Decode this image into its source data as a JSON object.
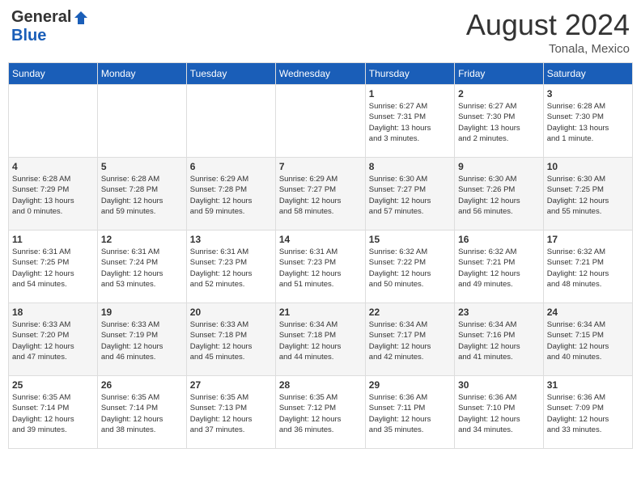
{
  "header": {
    "logo_general": "General",
    "logo_blue": "Blue",
    "month_year": "August 2024",
    "location": "Tonala, Mexico"
  },
  "weekdays": [
    "Sunday",
    "Monday",
    "Tuesday",
    "Wednesday",
    "Thursday",
    "Friday",
    "Saturday"
  ],
  "weeks": [
    [
      {
        "day": "",
        "info": ""
      },
      {
        "day": "",
        "info": ""
      },
      {
        "day": "",
        "info": ""
      },
      {
        "day": "",
        "info": ""
      },
      {
        "day": "1",
        "info": "Sunrise: 6:27 AM\nSunset: 7:31 PM\nDaylight: 13 hours\nand 3 minutes."
      },
      {
        "day": "2",
        "info": "Sunrise: 6:27 AM\nSunset: 7:30 PM\nDaylight: 13 hours\nand 2 minutes."
      },
      {
        "day": "3",
        "info": "Sunrise: 6:28 AM\nSunset: 7:30 PM\nDaylight: 13 hours\nand 1 minute."
      }
    ],
    [
      {
        "day": "4",
        "info": "Sunrise: 6:28 AM\nSunset: 7:29 PM\nDaylight: 13 hours\nand 0 minutes."
      },
      {
        "day": "5",
        "info": "Sunrise: 6:28 AM\nSunset: 7:28 PM\nDaylight: 12 hours\nand 59 minutes."
      },
      {
        "day": "6",
        "info": "Sunrise: 6:29 AM\nSunset: 7:28 PM\nDaylight: 12 hours\nand 59 minutes."
      },
      {
        "day": "7",
        "info": "Sunrise: 6:29 AM\nSunset: 7:27 PM\nDaylight: 12 hours\nand 58 minutes."
      },
      {
        "day": "8",
        "info": "Sunrise: 6:30 AM\nSunset: 7:27 PM\nDaylight: 12 hours\nand 57 minutes."
      },
      {
        "day": "9",
        "info": "Sunrise: 6:30 AM\nSunset: 7:26 PM\nDaylight: 12 hours\nand 56 minutes."
      },
      {
        "day": "10",
        "info": "Sunrise: 6:30 AM\nSunset: 7:25 PM\nDaylight: 12 hours\nand 55 minutes."
      }
    ],
    [
      {
        "day": "11",
        "info": "Sunrise: 6:31 AM\nSunset: 7:25 PM\nDaylight: 12 hours\nand 54 minutes."
      },
      {
        "day": "12",
        "info": "Sunrise: 6:31 AM\nSunset: 7:24 PM\nDaylight: 12 hours\nand 53 minutes."
      },
      {
        "day": "13",
        "info": "Sunrise: 6:31 AM\nSunset: 7:23 PM\nDaylight: 12 hours\nand 52 minutes."
      },
      {
        "day": "14",
        "info": "Sunrise: 6:31 AM\nSunset: 7:23 PM\nDaylight: 12 hours\nand 51 minutes."
      },
      {
        "day": "15",
        "info": "Sunrise: 6:32 AM\nSunset: 7:22 PM\nDaylight: 12 hours\nand 50 minutes."
      },
      {
        "day": "16",
        "info": "Sunrise: 6:32 AM\nSunset: 7:21 PM\nDaylight: 12 hours\nand 49 minutes."
      },
      {
        "day": "17",
        "info": "Sunrise: 6:32 AM\nSunset: 7:21 PM\nDaylight: 12 hours\nand 48 minutes."
      }
    ],
    [
      {
        "day": "18",
        "info": "Sunrise: 6:33 AM\nSunset: 7:20 PM\nDaylight: 12 hours\nand 47 minutes."
      },
      {
        "day": "19",
        "info": "Sunrise: 6:33 AM\nSunset: 7:19 PM\nDaylight: 12 hours\nand 46 minutes."
      },
      {
        "day": "20",
        "info": "Sunrise: 6:33 AM\nSunset: 7:18 PM\nDaylight: 12 hours\nand 45 minutes."
      },
      {
        "day": "21",
        "info": "Sunrise: 6:34 AM\nSunset: 7:18 PM\nDaylight: 12 hours\nand 44 minutes."
      },
      {
        "day": "22",
        "info": "Sunrise: 6:34 AM\nSunset: 7:17 PM\nDaylight: 12 hours\nand 42 minutes."
      },
      {
        "day": "23",
        "info": "Sunrise: 6:34 AM\nSunset: 7:16 PM\nDaylight: 12 hours\nand 41 minutes."
      },
      {
        "day": "24",
        "info": "Sunrise: 6:34 AM\nSunset: 7:15 PM\nDaylight: 12 hours\nand 40 minutes."
      }
    ],
    [
      {
        "day": "25",
        "info": "Sunrise: 6:35 AM\nSunset: 7:14 PM\nDaylight: 12 hours\nand 39 minutes."
      },
      {
        "day": "26",
        "info": "Sunrise: 6:35 AM\nSunset: 7:14 PM\nDaylight: 12 hours\nand 38 minutes."
      },
      {
        "day": "27",
        "info": "Sunrise: 6:35 AM\nSunset: 7:13 PM\nDaylight: 12 hours\nand 37 minutes."
      },
      {
        "day": "28",
        "info": "Sunrise: 6:35 AM\nSunset: 7:12 PM\nDaylight: 12 hours\nand 36 minutes."
      },
      {
        "day": "29",
        "info": "Sunrise: 6:36 AM\nSunset: 7:11 PM\nDaylight: 12 hours\nand 35 minutes."
      },
      {
        "day": "30",
        "info": "Sunrise: 6:36 AM\nSunset: 7:10 PM\nDaylight: 12 hours\nand 34 minutes."
      },
      {
        "day": "31",
        "info": "Sunrise: 6:36 AM\nSunset: 7:09 PM\nDaylight: 12 hours\nand 33 minutes."
      }
    ]
  ]
}
